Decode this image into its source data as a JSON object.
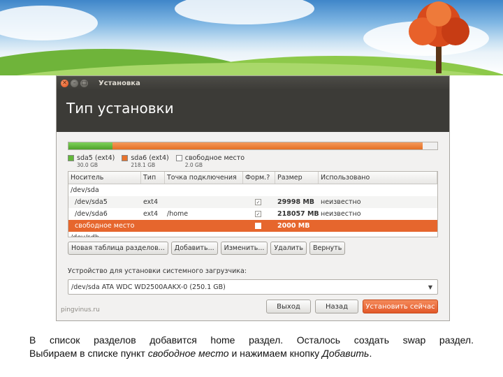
{
  "window": {
    "title": "Установка",
    "page_title": "Тип установки"
  },
  "partition_bar": {
    "segments": [
      {
        "name": "sda5",
        "fraction": 0.12,
        "color": "#62b83a"
      },
      {
        "name": "sda6",
        "fraction": 0.84,
        "color": "#e8732c"
      },
      {
        "name": "free",
        "fraction": 0.04,
        "color": "#f0f0f0"
      }
    ]
  },
  "legend": [
    {
      "label": "sda5 (ext4)",
      "size": "30.0 GB",
      "color": "#62b83a"
    },
    {
      "label": "sda6 (ext4)",
      "size": "218.1 GB",
      "color": "#e8732c"
    },
    {
      "label": "свободное место",
      "size": "2.0 GB",
      "color": "#ffffff"
    }
  ],
  "table": {
    "headers": [
      "Носитель",
      "Тип",
      "Точка подключения",
      "Форм.?",
      "Размер",
      "Использовано"
    ],
    "rows": [
      {
        "device": "/dev/sda",
        "type": "",
        "mount": "",
        "format": null,
        "size": "",
        "used": ""
      },
      {
        "device": "  /dev/sda5",
        "type": "ext4",
        "mount": "",
        "format": true,
        "size": "29998 MB",
        "used": "неизвестно"
      },
      {
        "device": "  /dev/sda6",
        "type": "ext4",
        "mount": "/home",
        "format": true,
        "size": "218057 MB",
        "used": "неизвестно"
      },
      {
        "device": "  свободное место",
        "type": "",
        "mount": "",
        "format": false,
        "size": "2000 MB",
        "used": ""
      },
      {
        "device": "/dev/sdb",
        "type": "",
        "mount": "",
        "format": null,
        "size": "",
        "used": ""
      }
    ],
    "selected_row": 3
  },
  "buttons": {
    "new_table": "Новая таблица разделов...",
    "add": "Добавить...",
    "change": "Изменить...",
    "delete": "Удалить",
    "revert": "Вернуть"
  },
  "bootloader": {
    "label": "Устройство для установки системного загрузчика:",
    "value": "/dev/sda   ATA WDC WD2500AAKX-0 (250.1 GB)"
  },
  "footer": {
    "brand": "pingvinus.ru",
    "quit": "Выход",
    "back": "Назад",
    "install": "Установить сейчас"
  },
  "caption": {
    "line1": "В список разделов добавится home раздел. Осталось создать swap раздел.",
    "line2_prefix": "Выбираем в списке пункт ",
    "line2_em1": "свободное место",
    "line2_mid": " и нажимаем кнопку ",
    "line2_em2": "Добавить",
    "line2_end": "."
  }
}
